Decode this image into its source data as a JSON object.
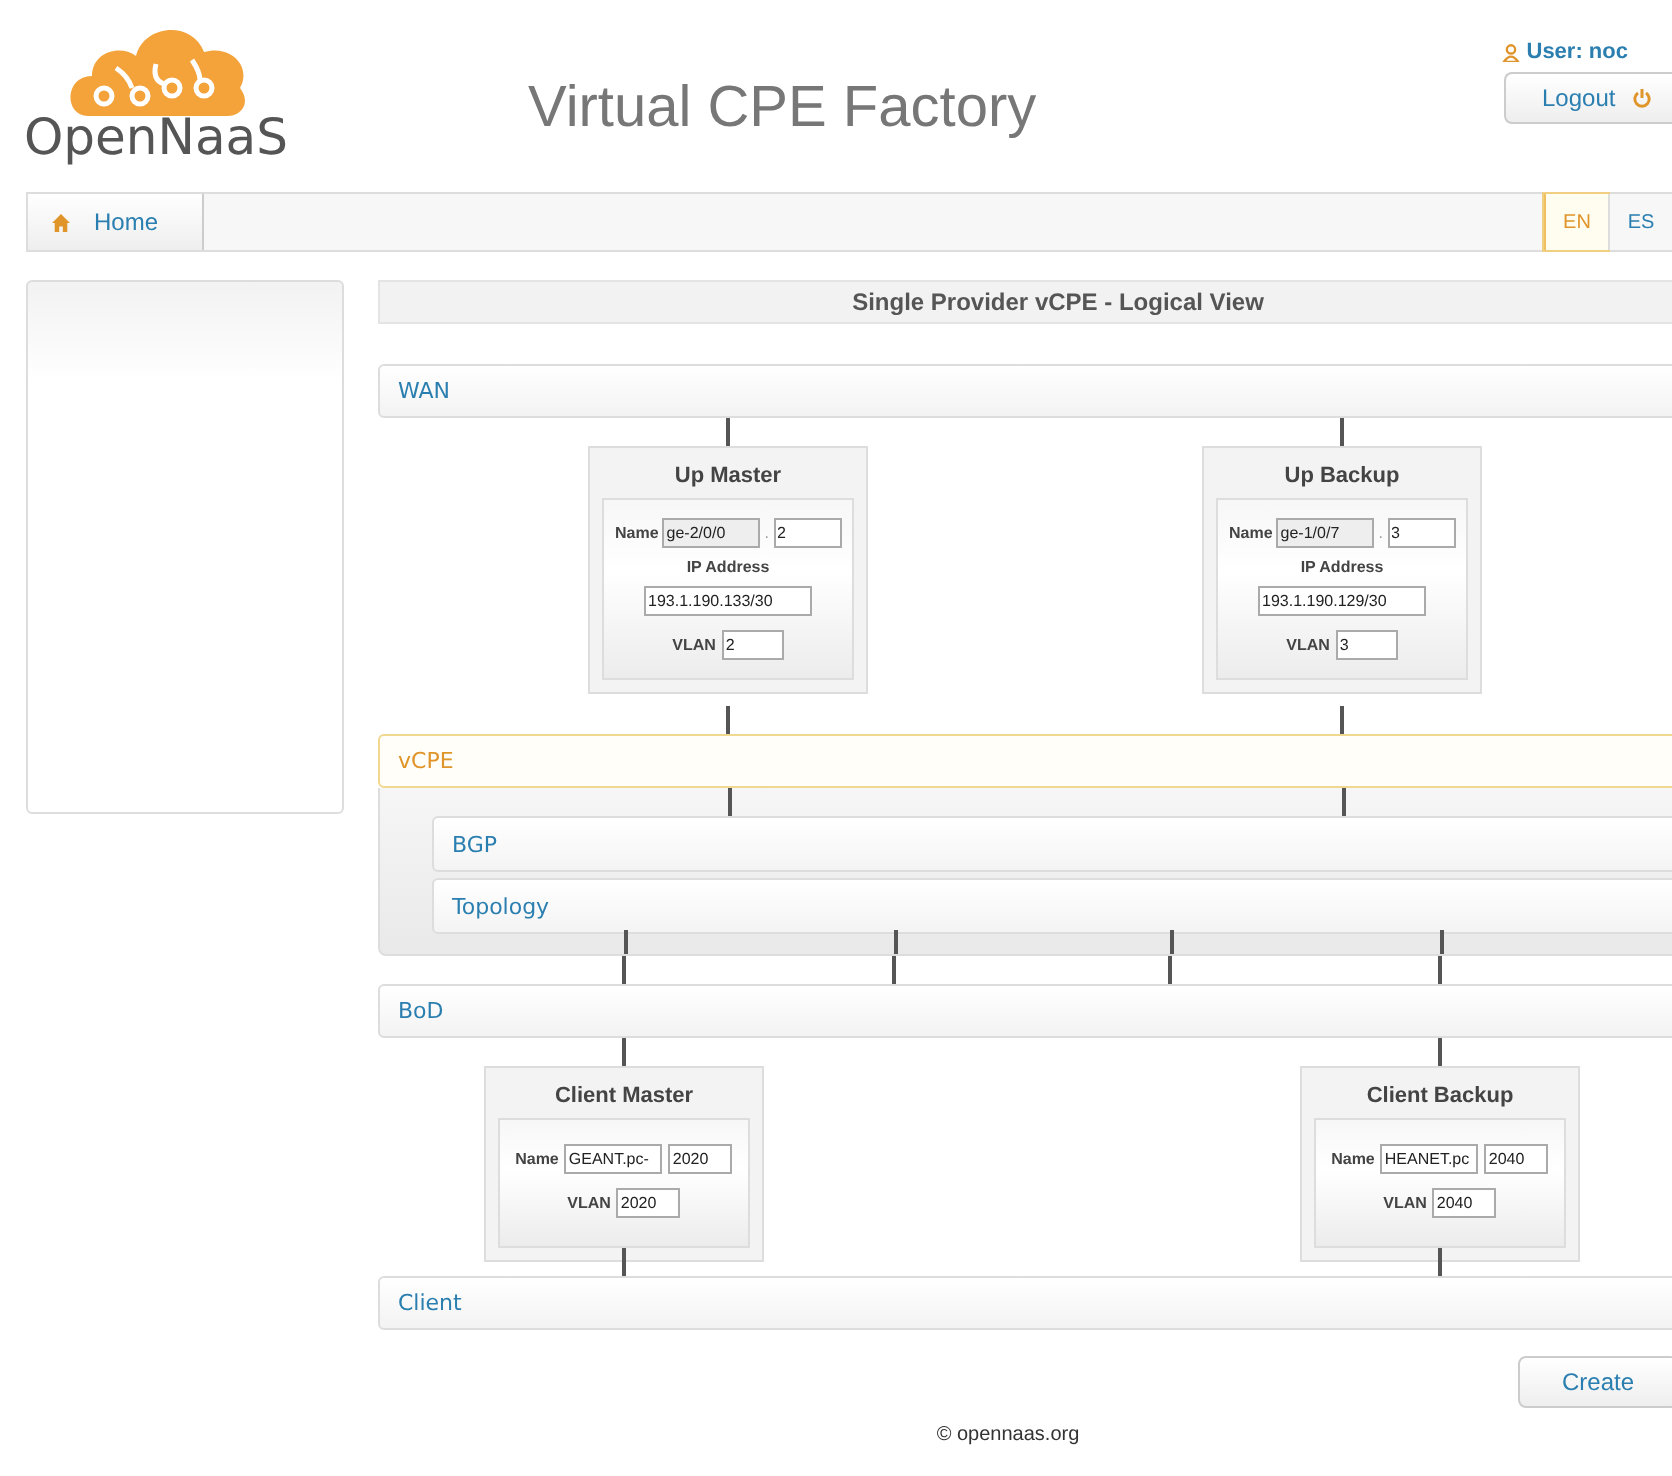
{
  "header": {
    "logo": "OpenNaaS",
    "title": "Virtual CPE Factory",
    "user": "User: noc",
    "logout": "Logout"
  },
  "nav": {
    "home": "Home",
    "languages": [
      {
        "label": "EN",
        "selected": true
      },
      {
        "label": "ES",
        "selected": false
      }
    ]
  },
  "view_title": "Single Provider vCPE - Logical View",
  "wan": {
    "label": "WAN",
    "active": false
  },
  "uplinks": [
    {
      "title": "Up Master",
      "name_label": "Name",
      "name": "ge-2/0/0",
      "name_disabled": true,
      "separator": ".",
      "unit": "2",
      "ip_label": "IP Address",
      "ip": "193.1.190.133/30",
      "vlan_label": "VLAN",
      "vlan": "2"
    },
    {
      "title": "Up Backup",
      "name_label": "Name",
      "name": "ge-1/0/7",
      "name_disabled": true,
      "separator": ".",
      "unit": "3",
      "ip_label": "IP Address",
      "ip": "193.1.190.129/30",
      "vlan_label": "VLAN",
      "vlan": "3"
    }
  ],
  "vcpe": {
    "label": "vCPE",
    "active": true,
    "children": [
      {
        "label": "BGP"
      },
      {
        "label": "Topology"
      }
    ]
  },
  "bod": {
    "label": "BoD",
    "active": false
  },
  "clients": [
    {
      "title": "Client Master",
      "name_label": "Name",
      "name": "GEANT.pc-",
      "name_disabled": false,
      "unit": "2020",
      "vlan_label": "VLAN",
      "vlan": "2020"
    },
    {
      "title": "Client Backup",
      "name_label": "Name",
      "name": "HEANET.pc",
      "name_disabled": false,
      "unit": "2040",
      "vlan_label": "VLAN",
      "vlan": "2040"
    }
  ],
  "client": {
    "label": "Client",
    "active": false
  },
  "create": "Create",
  "footer": "© opennaas.org"
}
